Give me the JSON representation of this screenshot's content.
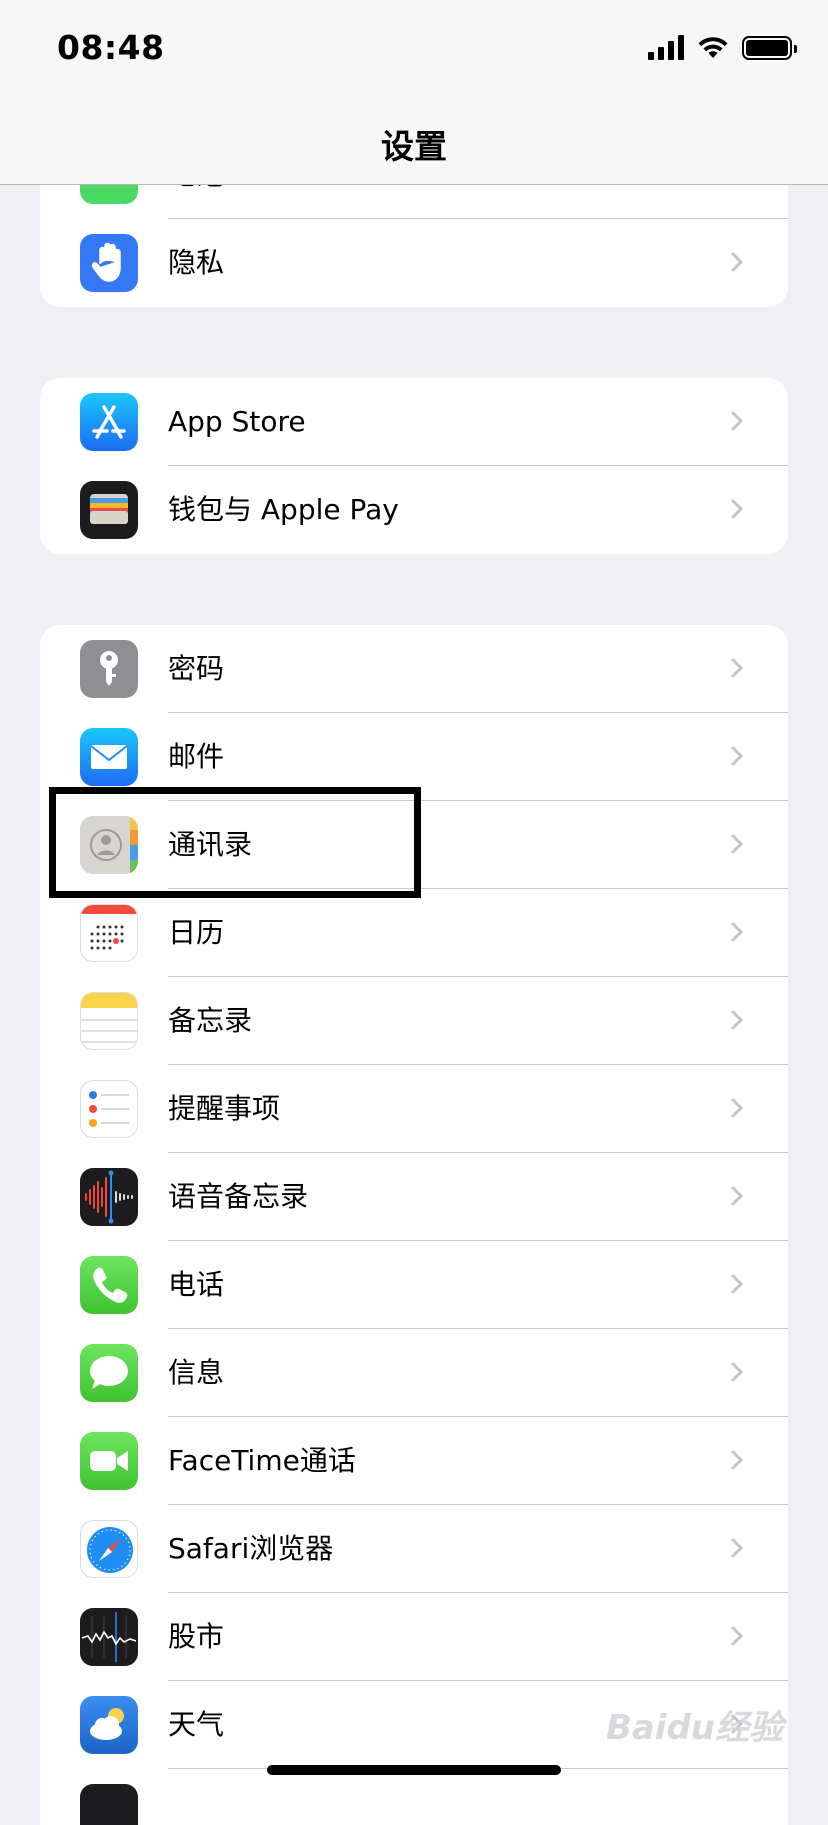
{
  "status_bar": {
    "time": "08:48"
  },
  "nav": {
    "title": "设置"
  },
  "group1": [
    {
      "label": "电池",
      "icon": "battery-icon",
      "color": "#4cd964"
    },
    {
      "label": "隐私",
      "icon": "hand-icon",
      "color": "#3478f6"
    }
  ],
  "group2": [
    {
      "label": "App Store",
      "icon": "app-store-icon",
      "color": "#1e8ef5"
    },
    {
      "label": "钱包与 Apple Pay",
      "icon": "wallet-icon",
      "color": "#1c1c1e"
    }
  ],
  "group3": [
    {
      "label": "密码",
      "icon": "key-icon",
      "color": "#8e8e93"
    },
    {
      "label": "邮件",
      "icon": "mail-icon",
      "color": "#1f8ff5"
    },
    {
      "label": "通讯录",
      "icon": "contacts-icon",
      "color": "#c9c8c4"
    },
    {
      "label": "日历",
      "icon": "calendar-icon",
      "color": "#ffffff"
    },
    {
      "label": "备忘录",
      "icon": "notes-icon",
      "color": "#ffffff"
    },
    {
      "label": "提醒事项",
      "icon": "reminders-icon",
      "color": "#ffffff"
    },
    {
      "label": "语音备忘录",
      "icon": "voice-memos-icon",
      "color": "#1c1c1e"
    },
    {
      "label": "电话",
      "icon": "phone-icon",
      "color": "#4cd964"
    },
    {
      "label": "信息",
      "icon": "messages-icon",
      "color": "#4cd964"
    },
    {
      "label": "FaceTime通话",
      "icon": "facetime-icon",
      "color": "#4cd964"
    },
    {
      "label": "Safari浏览器",
      "icon": "safari-icon",
      "color": "#ffffff"
    },
    {
      "label": "股市",
      "icon": "stocks-icon",
      "color": "#1c1c1e"
    },
    {
      "label": "天气",
      "icon": "weather-icon",
      "color": "#2d7ee8"
    }
  ],
  "watermark": "Baidu经验"
}
